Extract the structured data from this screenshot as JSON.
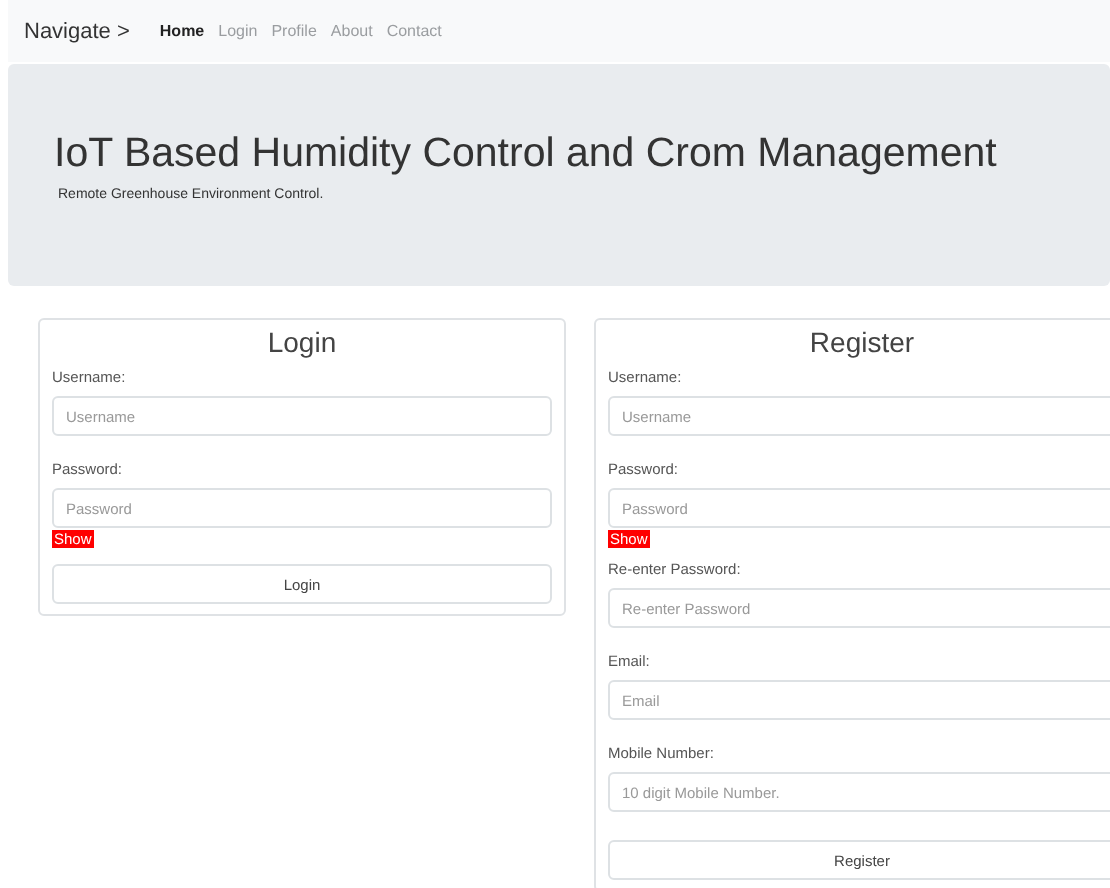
{
  "navbar": {
    "brand": "Navigate >",
    "links": [
      {
        "label": "Home",
        "selected": true
      },
      {
        "label": "Login",
        "selected": false
      },
      {
        "label": "Profile",
        "selected": false
      },
      {
        "label": "About",
        "selected": false
      },
      {
        "label": "Contact",
        "selected": false
      }
    ]
  },
  "header": {
    "title": "IoT Based Humidity Control and Crom Management",
    "subtitle": "Remote Greenhouse Environment Control."
  },
  "forms": [
    {
      "title": "Login",
      "fields": [
        {
          "label": "Username:",
          "placeholder": "Username"
        },
        {
          "label": "Password:",
          "placeholder": "Password",
          "toggle": "Show"
        }
      ],
      "button": "Login"
    },
    {
      "title": "Register",
      "fields": [
        {
          "label": "Username:",
          "placeholder": "Username"
        },
        {
          "label": "Password:",
          "placeholder": "Password",
          "toggle": "Show"
        },
        {
          "label": "Re-enter Password:",
          "placeholder": "Re-enter Password"
        },
        {
          "label": "Email:",
          "placeholder": "Email"
        },
        {
          "label": "Mobile Number:",
          "placeholder": "10 digit Mobile Number."
        }
      ],
      "button": "Register"
    }
  ]
}
